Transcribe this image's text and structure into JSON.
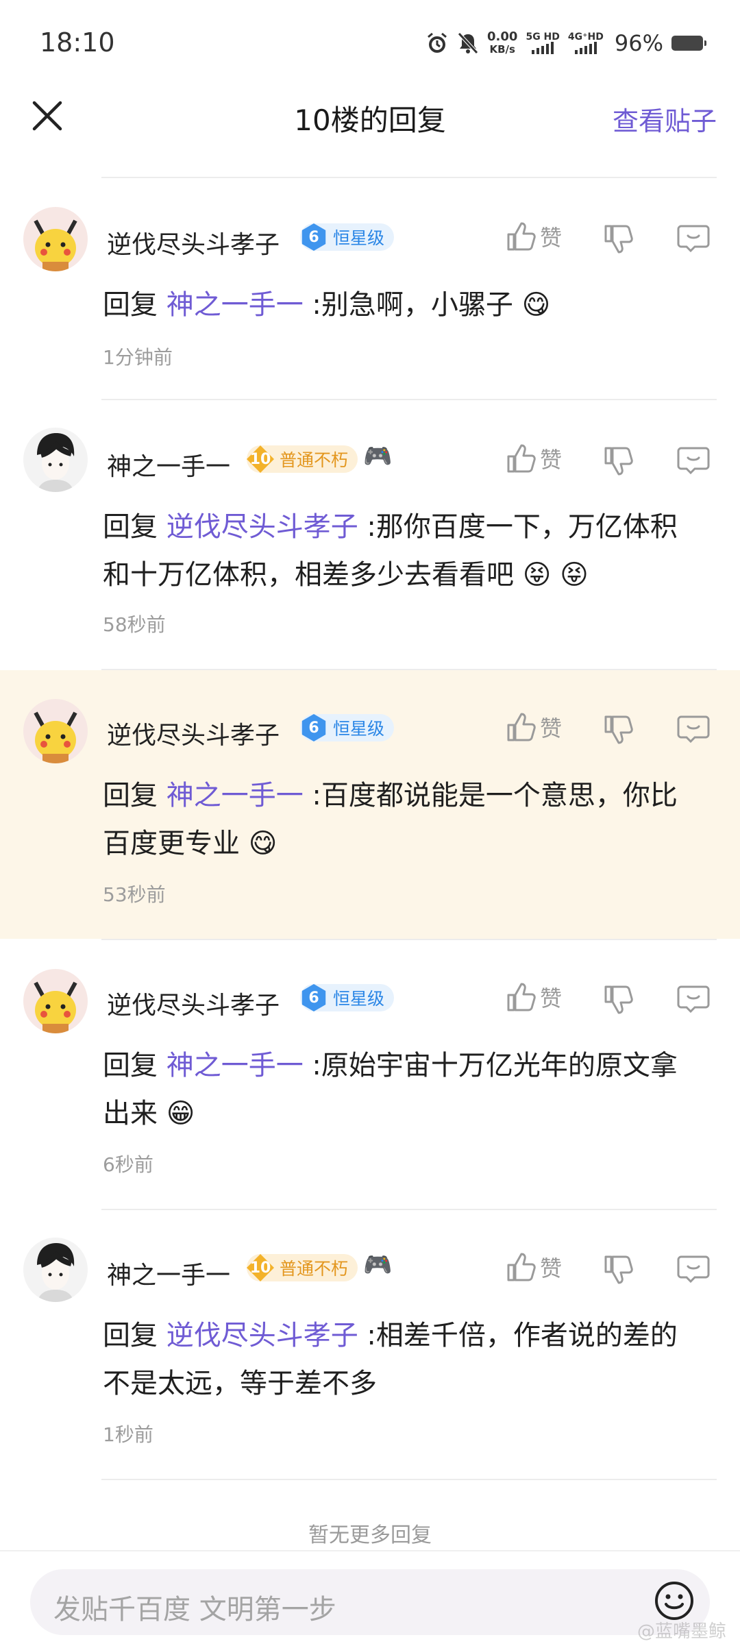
{
  "status_bar": {
    "time": "18:10",
    "speed_value": "0.00",
    "speed_unit": "KB/s",
    "net1_top": "5G HD",
    "net2_top": "4G⁺HD",
    "battery": "96%"
  },
  "header": {
    "title": "10楼的回复",
    "view_post": "查看贴子"
  },
  "actions": {
    "like_label": "赞"
  },
  "replies": [
    {
      "user": "逆伐尽头斗孝子",
      "level": "6",
      "rank": "恒星级",
      "prefix": "回复 ",
      "mention": "神之一手一",
      "line1": " :别急啊，小骡子 😋",
      "line2": "",
      "time": "1分钟前"
    },
    {
      "user": "神之一手一",
      "level": "10",
      "rank": "普通不朽",
      "extra": "🎮",
      "prefix": "回复 ",
      "mention": "逆伐尽头斗孝子",
      "line1": " :那你百度一下，万亿体积",
      "line2": "和十万亿体积，相差多少去看看吧 😝 😝",
      "time": "58秒前"
    },
    {
      "user": "逆伐尽头斗孝子",
      "level": "6",
      "rank": "恒星级",
      "prefix": "回复 ",
      "mention": "神之一手一",
      "line1": " :百度都说能是一个意思，你比",
      "line2": "百度更专业 😋",
      "time": "53秒前"
    },
    {
      "user": "逆伐尽头斗孝子",
      "level": "6",
      "rank": "恒星级",
      "prefix": "回复 ",
      "mention": "神之一手一",
      "line1": " :原始宇宙十万亿光年的原文拿",
      "line2": "出来 😁",
      "time": "6秒前"
    },
    {
      "user": "神之一手一",
      "level": "10",
      "rank": "普通不朽",
      "extra": "🎮",
      "prefix": "回复 ",
      "mention": "逆伐尽头斗孝子",
      "line1": " :相差千倍，作者说的差的",
      "line2": "不是太远，等于差不多",
      "time": "1秒前"
    }
  ],
  "no_more": "暂无更多回复",
  "compose": {
    "placeholder": "发贴千百度 文明第一步"
  },
  "watermark": "@蓝嘴墨鲸"
}
